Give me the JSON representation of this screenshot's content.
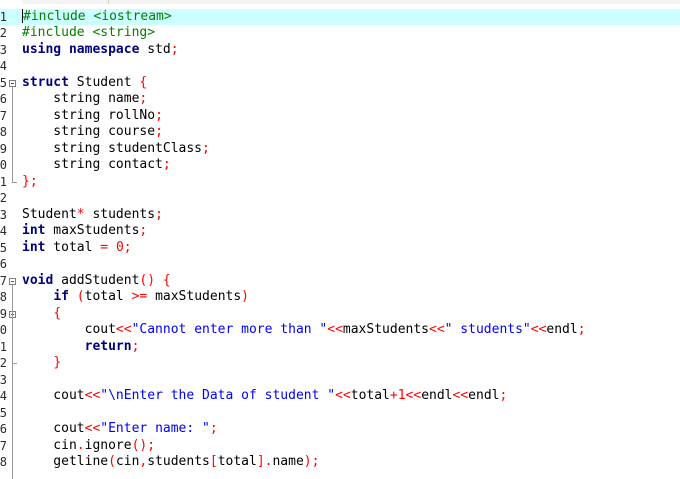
{
  "editor": {
    "lines": [
      {
        "n": "1",
        "html": "<span class=\"caret\"></span><span class=\"pp\">#include &lt;iostream&gt;</span>",
        "current": true
      },
      {
        "n": "2",
        "html": "<span class=\"pp\">#include &lt;string&gt;</span>"
      },
      {
        "n": "3",
        "html": "<span class=\"kw\">using namespace</span> std<span class=\"op\">;</span>"
      },
      {
        "n": "4",
        "html": ""
      },
      {
        "n": "5",
        "html": "<span class=\"kw\">struct</span> Student <span class=\"br\">{</span>",
        "fold": true
      },
      {
        "n": "6",
        "html": "    string name<span class=\"op\">;</span>"
      },
      {
        "n": "7",
        "html": "    string rollNo<span class=\"op\">;</span>"
      },
      {
        "n": "8",
        "html": "    string course<span class=\"op\">;</span>"
      },
      {
        "n": "9",
        "html": "    string studentClass<span class=\"op\">;</span>"
      },
      {
        "n": "0",
        "html": "    string contact<span class=\"op\">;</span>"
      },
      {
        "n": "1",
        "html": "<span class=\"br\">}</span><span class=\"op\">;</span>"
      },
      {
        "n": "2",
        "html": ""
      },
      {
        "n": "3",
        "html": "Student<span class=\"op\">*</span> students<span class=\"op\">;</span>"
      },
      {
        "n": "4",
        "html": "<span class=\"kw\">int</span> maxStudents<span class=\"op\">;</span>"
      },
      {
        "n": "5",
        "html": "<span class=\"kw\">int</span> total <span class=\"op\">=</span> <span class=\"num\">0</span><span class=\"op\">;</span>"
      },
      {
        "n": "6",
        "html": ""
      },
      {
        "n": "7",
        "html": "<span class=\"kw\">void</span> addStudent<span class=\"br\">()</span> <span class=\"br\">{</span>",
        "fold": true
      },
      {
        "n": "8",
        "html": "    <span class=\"kw\">if</span> <span class=\"br\">(</span>total <span class=\"op\">&gt;=</span> maxStudents<span class=\"br\">)</span>"
      },
      {
        "n": "9",
        "html": "    <span class=\"br\">{</span>",
        "fold": true
      },
      {
        "n": "0",
        "html": "        cout<span class=\"op\">&lt;&lt;</span><span class=\"str\">\"Cannot enter more than \"</span><span class=\"op\">&lt;&lt;</span>maxStudents<span class=\"op\">&lt;&lt;</span><span class=\"str\">\" students\"</span><span class=\"op\">&lt;&lt;</span>endl<span class=\"op\">;</span>"
      },
      {
        "n": "1",
        "html": "        <span class=\"kw\">return</span><span class=\"op\">;</span>"
      },
      {
        "n": "2",
        "html": "    <span class=\"br\">}</span>"
      },
      {
        "n": "3",
        "html": ""
      },
      {
        "n": "4",
        "html": "    cout<span class=\"op\">&lt;&lt;</span><span class=\"str\">\"\\nEnter the Data of student \"</span><span class=\"op\">&lt;&lt;</span>total<span class=\"op\">+</span><span class=\"num\">1</span><span class=\"op\">&lt;&lt;</span>endl<span class=\"op\">&lt;&lt;</span>endl<span class=\"op\">;</span>"
      },
      {
        "n": "5",
        "html": ""
      },
      {
        "n": "6",
        "html": "    cout<span class=\"op\">&lt;&lt;</span><span class=\"str\">\"Enter name: \"</span><span class=\"op\">;</span>"
      },
      {
        "n": "7",
        "html": "    cin<span class=\"op\">.</span>ignore<span class=\"br\">()</span><span class=\"op\">;</span>"
      },
      {
        "n": "8",
        "html": "    getline<span class=\"br\">(</span>cin<span class=\"op\">,</span>students<span class=\"br\">[</span>total<span class=\"br\">]</span><span class=\"op\">.</span>name<span class=\"br\">)</span><span class=\"op\">;</span>"
      }
    ]
  }
}
